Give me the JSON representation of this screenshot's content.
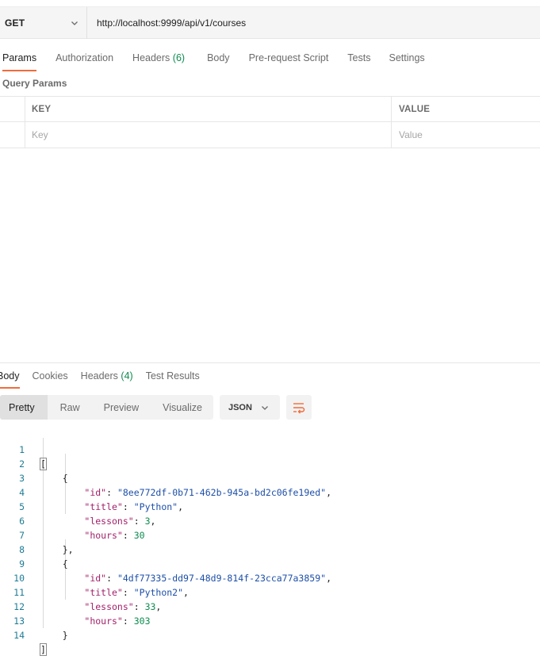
{
  "request": {
    "method": "GET",
    "url": "http://localhost:9999/api/v1/courses"
  },
  "request_tabs": [
    {
      "label": "Params",
      "count": ""
    },
    {
      "label": "Authorization",
      "count": ""
    },
    {
      "label": "Headers",
      "count": "(6)"
    },
    {
      "label": "Body",
      "count": ""
    },
    {
      "label": "Pre-request Script",
      "count": ""
    },
    {
      "label": "Tests",
      "count": ""
    },
    {
      "label": "Settings",
      "count": ""
    }
  ],
  "query_params": {
    "title": "Query Params",
    "key_header": "KEY",
    "value_header": "VALUE",
    "key_placeholder": "Key",
    "value_placeholder": "Value"
  },
  "response_tabs": [
    {
      "label": "Body",
      "count": ""
    },
    {
      "label": "Cookies",
      "count": ""
    },
    {
      "label": "Headers",
      "count": "(4)"
    },
    {
      "label": "Test Results",
      "count": ""
    }
  ],
  "view_modes": [
    "Pretty",
    "Raw",
    "Preview",
    "Visualize"
  ],
  "format": "JSON",
  "line_numbers": [
    "1",
    "2",
    "3",
    "4",
    "5",
    "6",
    "7",
    "8",
    "9",
    "10",
    "11",
    "12",
    "13",
    "14"
  ],
  "courses": [
    {
      "id": "\"8ee772df-0b71-462b-945a-bd2c06fe19ed\"",
      "title": "\"Python\"",
      "lessons": "3",
      "hours": "30"
    },
    {
      "id": "\"4df77335-dd97-48d9-814f-23cca77a3859\"",
      "title": "\"Python2\"",
      "lessons": "33",
      "hours": "303"
    }
  ],
  "keys": {
    "id": "\"id\"",
    "title": "\"title\"",
    "lessons": "\"lessons\"",
    "hours": "\"hours\""
  },
  "colors": {
    "accent": "#f26b3a",
    "count": "#0d8c4f",
    "json_key": "#a3226b",
    "json_string": "#1d4fa8",
    "json_number": "#0d8c4f"
  }
}
